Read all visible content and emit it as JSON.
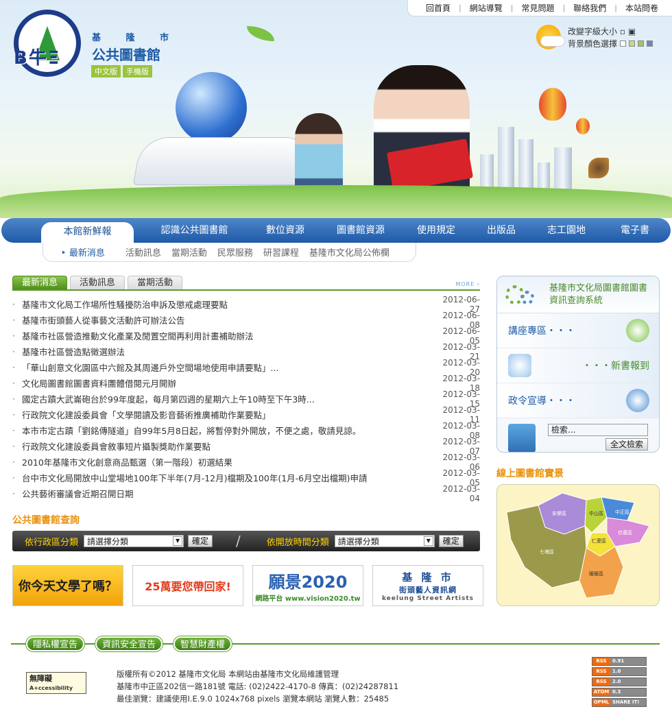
{
  "top_links": [
    "回首頁",
    "網站導覽",
    "常見問題",
    "聯絡我們",
    "本站問卷"
  ],
  "logo": {
    "city": "基 隆 市",
    "name": "公共圖書館",
    "versions": [
      "中文版",
      "手機版"
    ]
  },
  "settings": {
    "font_size_label": "改變字級大小",
    "bg_color_label": "背景顏色選擇",
    "swatches": [
      "#ffffff",
      "#c6d98a",
      "#a5c46a",
      "#6a8bbf"
    ]
  },
  "nav": {
    "items": [
      "本館新鮮報",
      "認識公共圖書館",
      "數位資源",
      "圖書館資源",
      "使用規定",
      "出版品",
      "志工園地",
      "電子書"
    ],
    "sub": [
      "最新消息",
      "活動訊息",
      "當期活動",
      "民眾服務",
      "研習課程",
      "基隆市文化局公佈欄"
    ]
  },
  "news": {
    "tabs": [
      "最新消息",
      "活動訊息",
      "當期活動"
    ],
    "more": "MORE",
    "items": [
      {
        "title": "基隆市文化局工作場所性騷擾防治申訴及懲戒處理要點",
        "date": "2012-06-27"
      },
      {
        "title": "基隆市街頭藝人從事藝文活動許可辦法公告",
        "date": "2012-06-08"
      },
      {
        "title": "基隆市社區營造推動文化產業及閒置空間再利用計畫補助辦法",
        "date": "2012-06-05"
      },
      {
        "title": "基隆市社區營造點徵選辦法",
        "date": "2012-03-21"
      },
      {
        "title": "「華山創意文化園區中六館及其周邊戶外空間場地使用申請要點」...",
        "date": "2012-03-20"
      },
      {
        "title": "文化局圖書館圖書資料團體借閱元月開辦",
        "date": "2012-03-18"
      },
      {
        "title": "國定古蹟大武崙砲台於99年度起，每月第四週的星期六上午10時至下午3時...",
        "date": "2012-03-15"
      },
      {
        "title": "行政院文化建設委員會「文學閱讀及影音藝術推廣補助作業要點」",
        "date": "2012-03-11"
      },
      {
        "title": "本市市定古蹟「劉銘傳隧道」自99年5月8日起，將暫停對外開放，不便之處，敬請見諒。",
        "date": "2012-03-08"
      },
      {
        "title": "行政院文化建設委員會敘事短片攝製獎助作業要點",
        "date": "2012-03-07"
      },
      {
        "title": "2010年基隆市文化創意商品甄選（第一階段）初選結果",
        "date": "2012-03-06"
      },
      {
        "title": "台中市文化局開放中山堂場地100年下半年(7月-12月)檔期及100年(1月-6月空出檔期)申請",
        "date": "2012-03-05"
      },
      {
        "title": "公共藝術審議會近期召開日期",
        "date": "2012-03-04"
      }
    ]
  },
  "library_query": {
    "title": "公共圖書館查詢",
    "district_label": "依行政區分類",
    "time_label": "依開放時間分類",
    "select_placeholder": "請選擇分類",
    "go": "確定"
  },
  "banners": [
    {
      "main": "你今天文學了嗎？",
      "sub": ""
    },
    {
      "main": "25萬要您帶回家!",
      "sub": ""
    },
    {
      "main": "願景2020",
      "sub": "網路平台 www.vision2020.tw"
    },
    {
      "main": "基 隆 市",
      "sub2": "街頭藝人資訊網",
      "sub": "keelung Street Artists"
    }
  ],
  "right": {
    "system_title": "基隆市文化局圖書館圖書資訊查詢系統",
    "lecture": "講座專區・・・",
    "new_books": "・・・新書報到",
    "policy": "政令宣導・・・",
    "search_placeholder": "檢索...",
    "search_button": "全文檢索"
  },
  "map": {
    "title": "線上圖書館實景",
    "districts": [
      "安樂區",
      "中山區",
      "中正區",
      "信義區",
      "仁愛區",
      "七堵區",
      "暖暖區"
    ]
  },
  "footer": {
    "buttons": [
      "隱私權宣告",
      "資訊安全宣告",
      "智慧財產權"
    ],
    "access_label": "無障礙",
    "access_sub": "A+ccessibility",
    "copyright": "版權所有©2012 基隆市文化局 本網站由基隆市文化局維護管理",
    "address": "基隆市中正區202信一路181號 電話: (02)2422-4170-8 傳真：(02)24287811",
    "browser": "最佳瀏覽：建議使用I.E.9.0 1024x768 pixels 瀏覽本網站 瀏覽人數：25485",
    "feeds": [
      {
        "a": "RSS",
        "b": "0.91"
      },
      {
        "a": "RSS",
        "b": "1.0"
      },
      {
        "a": "RSS",
        "b": "2.0"
      },
      {
        "a": "ATOM",
        "b": "0.3"
      },
      {
        "a": "OPML",
        "b": "SHARE IT!"
      }
    ]
  }
}
